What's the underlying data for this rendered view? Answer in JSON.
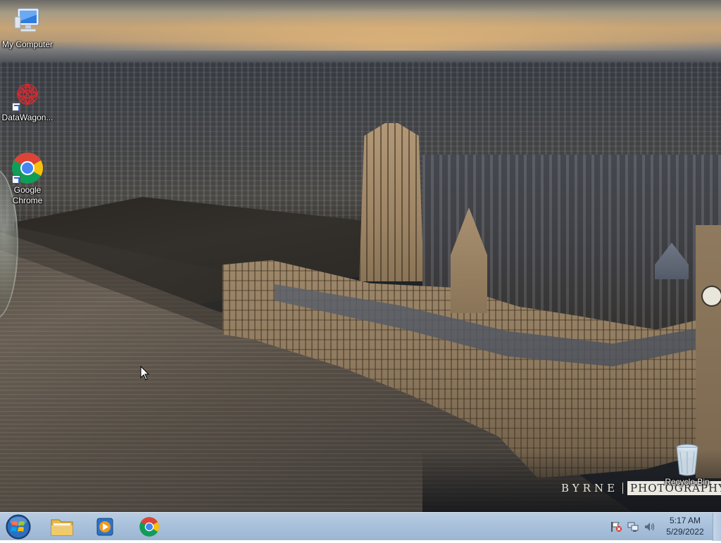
{
  "desktop": {
    "icons": [
      {
        "id": "my-computer",
        "label": "My Computer",
        "icon": "computer-icon",
        "shortcut": false
      },
      {
        "id": "datawagon",
        "label": "DataWagon...",
        "icon": "datawagon-icon",
        "shortcut": true
      },
      {
        "id": "google-chrome",
        "label": "Google Chrome",
        "icon": "chrome-icon",
        "shortcut": true
      },
      {
        "id": "recycle-bin",
        "label": "Recycle Bin",
        "icon": "recycle-bin-icon",
        "shortcut": false
      }
    ],
    "wallpaper": {
      "subject": "westminster-aerial",
      "watermark_left": "BYRNE",
      "watermark_right": "PHOTOGRAPHY"
    }
  },
  "taskbar": {
    "start_button": "start-orb-icon",
    "pinned": [
      {
        "id": "explorer",
        "icon": "folder-icon"
      },
      {
        "id": "media-player",
        "icon": "media-player-icon"
      },
      {
        "id": "chrome",
        "icon": "chrome-icon"
      }
    ],
    "tray": {
      "icons": [
        "action-center-icon",
        "network-icon",
        "volume-icon"
      ],
      "time": "5:17 AM",
      "date": "5/29/2022"
    }
  },
  "colors": {
    "taskbar": "#a9c1db",
    "chrome_red": "#db4437",
    "chrome_yellow": "#f4c20d",
    "chrome_green": "#0f9d58",
    "chrome_blue": "#4285f4"
  }
}
